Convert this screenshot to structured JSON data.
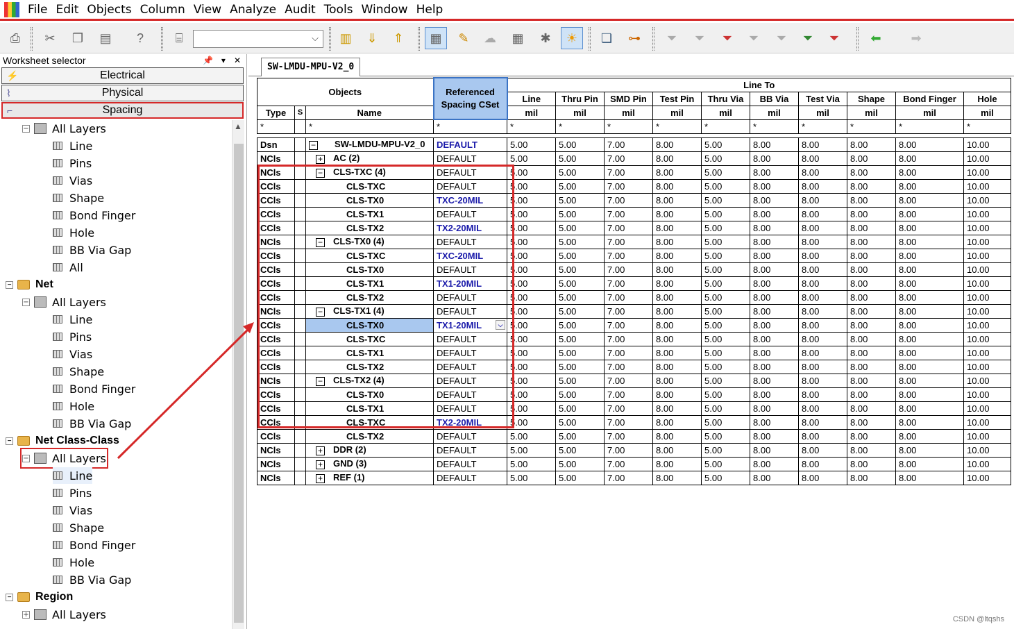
{
  "menu": [
    "File",
    "Edit",
    "Objects",
    "Column",
    "View",
    "Analyze",
    "Audit",
    "Tools",
    "Window",
    "Help"
  ],
  "toolbar": {
    "icons": [
      "print-icon",
      "cut-icon",
      "copy-icon",
      "paste-icon",
      "help-icon",
      "filter-select-icon",
      "combo",
      "net-class-icon",
      "up-arrow-icon",
      "down-arrow-icon",
      "sheet-table-icon",
      "edit-pencil-icon",
      "cloud-icon",
      "grid-icon",
      "star-icon",
      "sun-icon",
      "window-icon",
      "route-icon",
      "filter1-icon",
      "filter2-icon",
      "filter3-icon",
      "filter4-icon",
      "filter5-icon",
      "filter6-icon",
      "filter7-icon",
      "back-arrow-icon",
      "forward-arrow-icon"
    ],
    "combo_value": ""
  },
  "worksheet_selector": {
    "title": "Worksheet selector",
    "categories": [
      "Electrical",
      "Physical",
      "Spacing"
    ]
  },
  "tree": [
    {
      "label": "All Layers",
      "indent": 2,
      "kind": "layer",
      "exp": "−"
    },
    {
      "label": "Line",
      "indent": 3,
      "kind": "grid"
    },
    {
      "label": "Pins",
      "indent": 3,
      "kind": "grid"
    },
    {
      "label": "Vias",
      "indent": 3,
      "kind": "grid"
    },
    {
      "label": "Shape",
      "indent": 3,
      "kind": "grid"
    },
    {
      "label": "Bond Finger",
      "indent": 3,
      "kind": "grid"
    },
    {
      "label": "Hole",
      "indent": 3,
      "kind": "grid"
    },
    {
      "label": "BB Via Gap",
      "indent": 3,
      "kind": "grid"
    },
    {
      "label": "All",
      "indent": 3,
      "kind": "grid"
    },
    {
      "label": "Net",
      "indent": 1,
      "kind": "folder",
      "exp": "−",
      "bold": true
    },
    {
      "label": "All Layers",
      "indent": 2,
      "kind": "layer",
      "exp": "−"
    },
    {
      "label": "Line",
      "indent": 3,
      "kind": "grid"
    },
    {
      "label": "Pins",
      "indent": 3,
      "kind": "grid"
    },
    {
      "label": "Vias",
      "indent": 3,
      "kind": "grid"
    },
    {
      "label": "Shape",
      "indent": 3,
      "kind": "grid"
    },
    {
      "label": "Bond Finger",
      "indent": 3,
      "kind": "grid"
    },
    {
      "label": "Hole",
      "indent": 3,
      "kind": "grid"
    },
    {
      "label": "BB Via Gap",
      "indent": 3,
      "kind": "grid"
    },
    {
      "label": "Net Class-Class",
      "indent": 1,
      "kind": "folder",
      "exp": "−",
      "bold": true
    },
    {
      "label": "All Layers",
      "indent": 2,
      "kind": "layer",
      "exp": "−",
      "boxed": true
    },
    {
      "label": "Line",
      "indent": 3,
      "kind": "grid",
      "hl": true
    },
    {
      "label": "Pins",
      "indent": 3,
      "kind": "grid"
    },
    {
      "label": "Vias",
      "indent": 3,
      "kind": "grid"
    },
    {
      "label": "Shape",
      "indent": 3,
      "kind": "grid"
    },
    {
      "label": "Bond Finger",
      "indent": 3,
      "kind": "grid"
    },
    {
      "label": "Hole",
      "indent": 3,
      "kind": "grid"
    },
    {
      "label": "BB Via Gap",
      "indent": 3,
      "kind": "grid"
    },
    {
      "label": "Region",
      "indent": 1,
      "kind": "folder",
      "exp": "−",
      "bold": true
    },
    {
      "label": "All Layers",
      "indent": 2,
      "kind": "layer",
      "exp": "+"
    }
  ],
  "tab_label": "SW-LMDU-MPU-V2_0",
  "grid": {
    "objects_header": "Objects",
    "ref_header": "Referenced Spacing CSet",
    "lineto_header": "Line To",
    "type_header": "Type",
    "s_header": "S",
    "name_header": "Name",
    "columns": [
      "Line",
      "Thru Pin",
      "SMD Pin",
      "Test Pin",
      "Thru Via",
      "BB Via",
      "Test Via",
      "Shape",
      "Bond Finger",
      "Hole"
    ],
    "unit": "mil",
    "star": "*",
    "rows": [
      {
        "type": "Dsn",
        "exp": "−",
        "name": "SW-LMDU-MPU-V2_0",
        "level": 0,
        "cset": "DEFAULT",
        "blue": true,
        "v": [
          "5.00",
          "5.00",
          "7.00",
          "8.00",
          "5.00",
          "8.00",
          "8.00",
          "8.00",
          "8.00",
          "10.00"
        ]
      },
      {
        "type": "NCls",
        "exp": "+",
        "name": "AC (2)",
        "level": 1,
        "cset": "DEFAULT",
        "v": [
          "5.00",
          "5.00",
          "7.00",
          "8.00",
          "5.00",
          "8.00",
          "8.00",
          "8.00",
          "8.00",
          "10.00"
        ]
      },
      {
        "type": "NCls",
        "exp": "−",
        "name": "CLS-TXC (4)",
        "level": 1,
        "cset": "DEFAULT",
        "v": [
          "5.00",
          "5.00",
          "7.00",
          "8.00",
          "5.00",
          "8.00",
          "8.00",
          "8.00",
          "8.00",
          "10.00"
        ]
      },
      {
        "type": "CCls",
        "name": "CLS-TXC",
        "level": 2,
        "cset": "DEFAULT",
        "v": [
          "5.00",
          "5.00",
          "7.00",
          "8.00",
          "5.00",
          "8.00",
          "8.00",
          "8.00",
          "8.00",
          "10.00"
        ]
      },
      {
        "type": "CCls",
        "name": "CLS-TX0",
        "level": 2,
        "cset": "TXC-20MIL",
        "blue": true,
        "v": [
          "5.00",
          "5.00",
          "7.00",
          "8.00",
          "5.00",
          "8.00",
          "8.00",
          "8.00",
          "8.00",
          "10.00"
        ]
      },
      {
        "type": "CCls",
        "name": "CLS-TX1",
        "level": 2,
        "cset": "DEFAULT",
        "v": [
          "5.00",
          "5.00",
          "7.00",
          "8.00",
          "5.00",
          "8.00",
          "8.00",
          "8.00",
          "8.00",
          "10.00"
        ]
      },
      {
        "type": "CCls",
        "name": "CLS-TX2",
        "level": 2,
        "cset": "TX2-20MIL",
        "blue": true,
        "v": [
          "5.00",
          "5.00",
          "7.00",
          "8.00",
          "5.00",
          "8.00",
          "8.00",
          "8.00",
          "8.00",
          "10.00"
        ]
      },
      {
        "type": "NCls",
        "exp": "−",
        "name": "CLS-TX0 (4)",
        "level": 1,
        "cset": "DEFAULT",
        "v": [
          "5.00",
          "5.00",
          "7.00",
          "8.00",
          "5.00",
          "8.00",
          "8.00",
          "8.00",
          "8.00",
          "10.00"
        ]
      },
      {
        "type": "CCls",
        "name": "CLS-TXC",
        "level": 2,
        "cset": "TXC-20MIL",
        "blue": true,
        "v": [
          "5.00",
          "5.00",
          "7.00",
          "8.00",
          "5.00",
          "8.00",
          "8.00",
          "8.00",
          "8.00",
          "10.00"
        ]
      },
      {
        "type": "CCls",
        "name": "CLS-TX0",
        "level": 2,
        "cset": "DEFAULT",
        "v": [
          "5.00",
          "5.00",
          "7.00",
          "8.00",
          "5.00",
          "8.00",
          "8.00",
          "8.00",
          "8.00",
          "10.00"
        ]
      },
      {
        "type": "CCls",
        "name": "CLS-TX1",
        "level": 2,
        "cset": "TX1-20MIL",
        "blue": true,
        "v": [
          "5.00",
          "5.00",
          "7.00",
          "8.00",
          "5.00",
          "8.00",
          "8.00",
          "8.00",
          "8.00",
          "10.00"
        ]
      },
      {
        "type": "CCls",
        "name": "CLS-TX2",
        "level": 2,
        "cset": "DEFAULT",
        "v": [
          "5.00",
          "5.00",
          "7.00",
          "8.00",
          "5.00",
          "8.00",
          "8.00",
          "8.00",
          "8.00",
          "10.00"
        ]
      },
      {
        "type": "NCls",
        "exp": "−",
        "name": "CLS-TX1 (4)",
        "level": 1,
        "cset": "DEFAULT",
        "v": [
          "5.00",
          "5.00",
          "7.00",
          "8.00",
          "5.00",
          "8.00",
          "8.00",
          "8.00",
          "8.00",
          "10.00"
        ]
      },
      {
        "type": "CCls",
        "name": "CLS-TX0",
        "level": 2,
        "cset": "TX1-20MIL",
        "blue": true,
        "selected": true,
        "v": [
          "5.00",
          "5.00",
          "7.00",
          "8.00",
          "5.00",
          "8.00",
          "8.00",
          "8.00",
          "8.00",
          "10.00"
        ]
      },
      {
        "type": "CCls",
        "name": "CLS-TXC",
        "level": 2,
        "cset": "DEFAULT",
        "v": [
          "5.00",
          "5.00",
          "7.00",
          "8.00",
          "5.00",
          "8.00",
          "8.00",
          "8.00",
          "8.00",
          "10.00"
        ]
      },
      {
        "type": "CCls",
        "name": "CLS-TX1",
        "level": 2,
        "cset": "DEFAULT",
        "v": [
          "5.00",
          "5.00",
          "7.00",
          "8.00",
          "5.00",
          "8.00",
          "8.00",
          "8.00",
          "8.00",
          "10.00"
        ]
      },
      {
        "type": "CCls",
        "name": "CLS-TX2",
        "level": 2,
        "cset": "DEFAULT",
        "v": [
          "5.00",
          "5.00",
          "7.00",
          "8.00",
          "5.00",
          "8.00",
          "8.00",
          "8.00",
          "8.00",
          "10.00"
        ]
      },
      {
        "type": "NCls",
        "exp": "−",
        "name": "CLS-TX2 (4)",
        "level": 1,
        "cset": "DEFAULT",
        "v": [
          "5.00",
          "5.00",
          "7.00",
          "8.00",
          "5.00",
          "8.00",
          "8.00",
          "8.00",
          "8.00",
          "10.00"
        ]
      },
      {
        "type": "CCls",
        "name": "CLS-TX0",
        "level": 2,
        "cset": "DEFAULT",
        "v": [
          "5.00",
          "5.00",
          "7.00",
          "8.00",
          "5.00",
          "8.00",
          "8.00",
          "8.00",
          "8.00",
          "10.00"
        ]
      },
      {
        "type": "CCls",
        "name": "CLS-TX1",
        "level": 2,
        "cset": "DEFAULT",
        "v": [
          "5.00",
          "5.00",
          "7.00",
          "8.00",
          "5.00",
          "8.00",
          "8.00",
          "8.00",
          "8.00",
          "10.00"
        ]
      },
      {
        "type": "CCls",
        "name": "CLS-TXC",
        "level": 2,
        "cset": "TX2-20MIL",
        "blue": true,
        "v": [
          "5.00",
          "5.00",
          "7.00",
          "8.00",
          "5.00",
          "8.00",
          "8.00",
          "8.00",
          "8.00",
          "10.00"
        ]
      },
      {
        "type": "CCls",
        "name": "CLS-TX2",
        "level": 2,
        "cset": "DEFAULT",
        "v": [
          "5.00",
          "5.00",
          "7.00",
          "8.00",
          "5.00",
          "8.00",
          "8.00",
          "8.00",
          "8.00",
          "10.00"
        ]
      },
      {
        "type": "NCls",
        "exp": "+",
        "name": "DDR (2)",
        "level": 1,
        "cset": "DEFAULT",
        "v": [
          "5.00",
          "5.00",
          "7.00",
          "8.00",
          "5.00",
          "8.00",
          "8.00",
          "8.00",
          "8.00",
          "10.00"
        ]
      },
      {
        "type": "NCls",
        "exp": "+",
        "name": "GND (3)",
        "level": 1,
        "cset": "DEFAULT",
        "v": [
          "5.00",
          "5.00",
          "7.00",
          "8.00",
          "5.00",
          "8.00",
          "8.00",
          "8.00",
          "8.00",
          "10.00"
        ]
      },
      {
        "type": "NCls",
        "exp": "+",
        "name": "REF (1)",
        "level": 1,
        "cset": "DEFAULT",
        "v": [
          "5.00",
          "5.00",
          "7.00",
          "8.00",
          "5.00",
          "8.00",
          "8.00",
          "8.00",
          "8.00",
          "10.00"
        ]
      }
    ]
  },
  "watermark": "CSDN @ltqshs",
  "colors": {
    "annotation_red": "#d52828",
    "selection_blue": "#a9c8ef",
    "cset_blue": "#1a1aaa"
  }
}
